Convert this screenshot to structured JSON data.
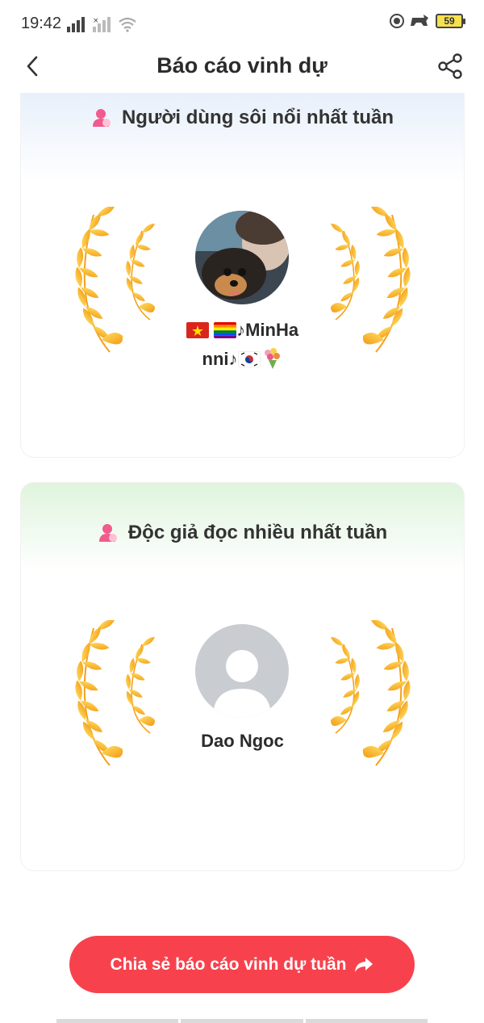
{
  "status_bar": {
    "time": "19:42",
    "battery": "59"
  },
  "header": {
    "title": "Báo cáo vinh dự"
  },
  "cards": [
    {
      "title": "Người dùng sôi nổi nhất tuần",
      "user_name_line1": "♪MinHa",
      "user_name_line2": "nni♪",
      "avatar": "photo-avatar"
    },
    {
      "title": "Độc giả đọc nhiều nhất tuần",
      "user_name": "Dao Ngoc",
      "avatar": "default-avatar"
    }
  ],
  "share_button": {
    "label": "Chia sẻ báo cáo vinh dự tuần"
  },
  "colors": {
    "accent": "#f7424d",
    "laurel_light": "#ffd34d",
    "laurel_dark": "#f5a01a",
    "person_icon": "#f15b8e"
  }
}
